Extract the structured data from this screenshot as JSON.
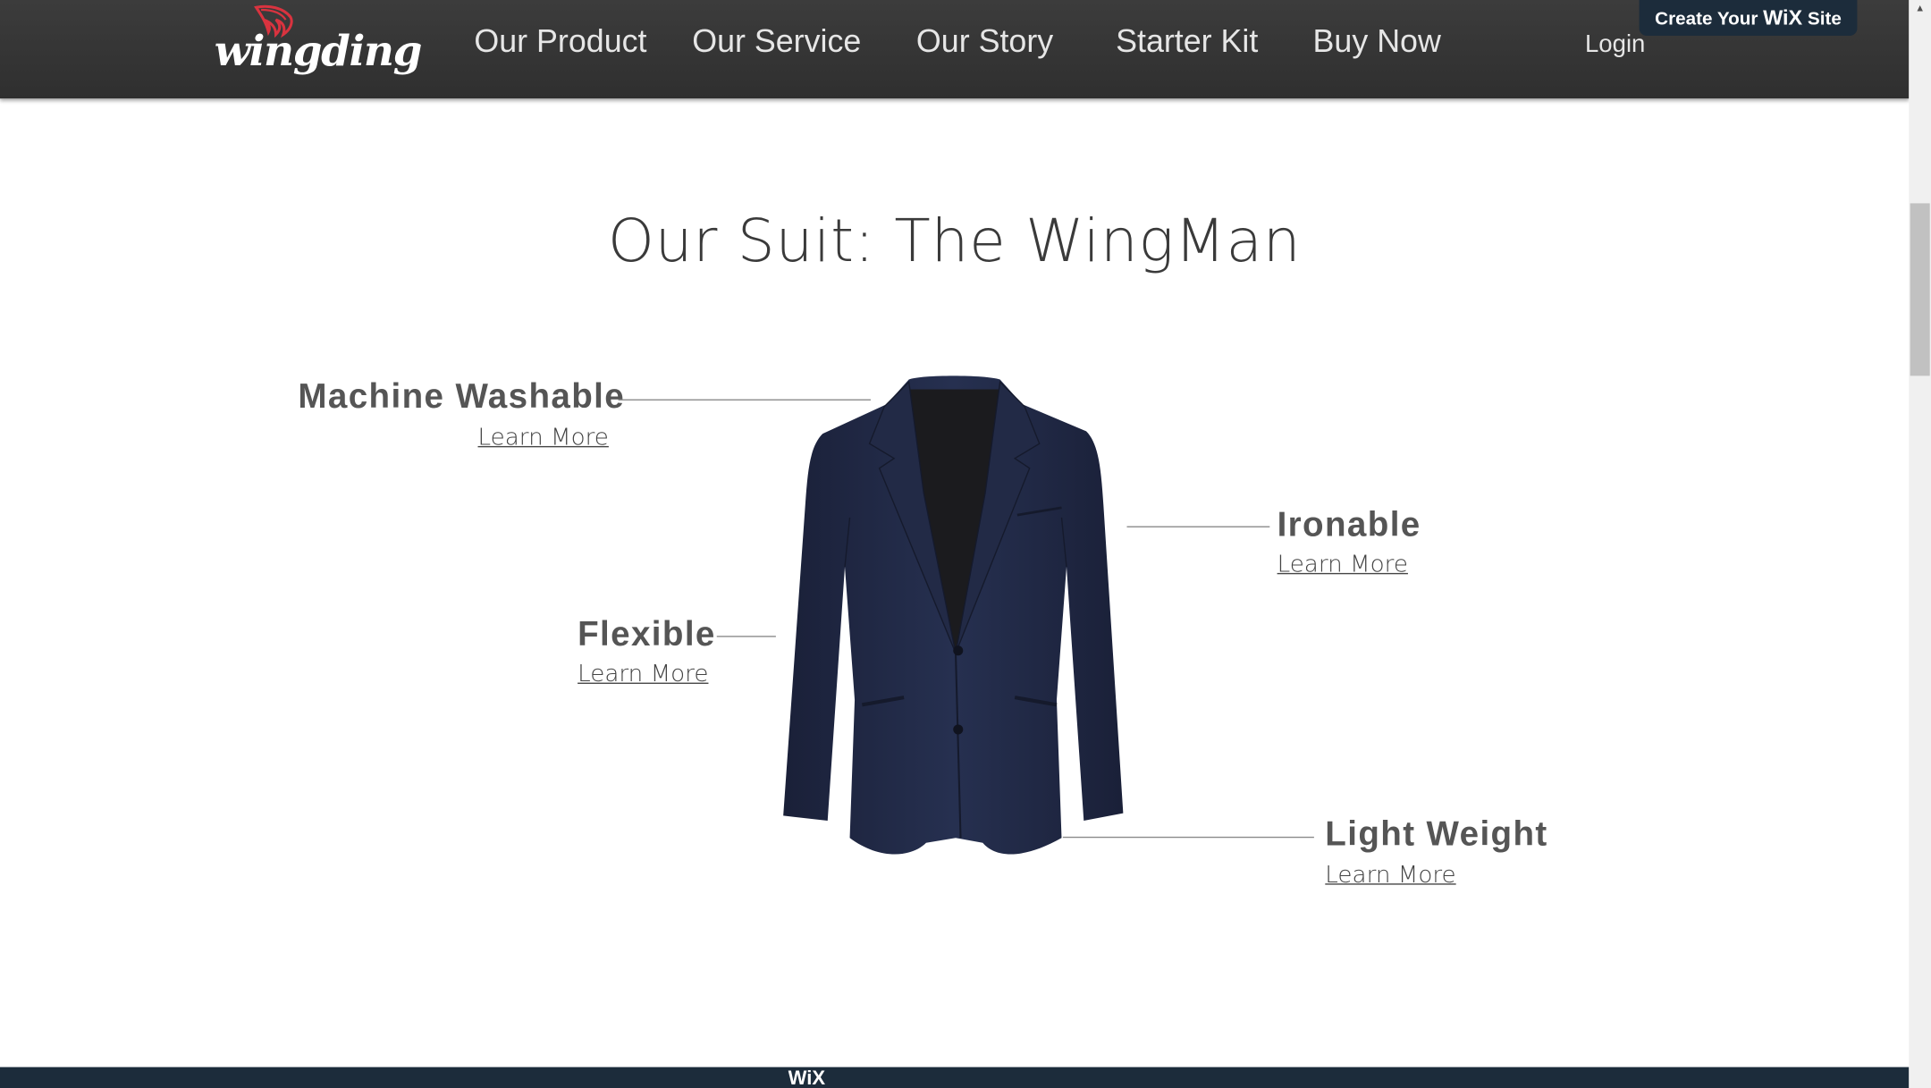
{
  "header": {
    "logo_text": "wingding",
    "nav": [
      {
        "label": "Our Product"
      },
      {
        "label": "Our Service"
      },
      {
        "label": "Our Story"
      },
      {
        "label": "Starter Kit"
      },
      {
        "label": "Buy Now"
      }
    ],
    "login_label": "Login",
    "wix_badge": {
      "prefix": "Create Your",
      "brand": "WiX",
      "suffix": "Site"
    }
  },
  "main": {
    "title": "Our Suit: The WingMan",
    "features": [
      {
        "label": "Machine Washable",
        "link": "Learn More"
      },
      {
        "label": "Ironable",
        "link": "Learn More"
      },
      {
        "label": "Flexible",
        "link": "Learn More"
      },
      {
        "label": "Light Weight",
        "link": "Learn More"
      }
    ]
  },
  "footer": {
    "brand": "WiX"
  },
  "colors": {
    "topbar": "#333333",
    "wix_badge_bg": "#1c2c3b",
    "logo_wing": "#d9333f",
    "suit": "#1f2640"
  }
}
